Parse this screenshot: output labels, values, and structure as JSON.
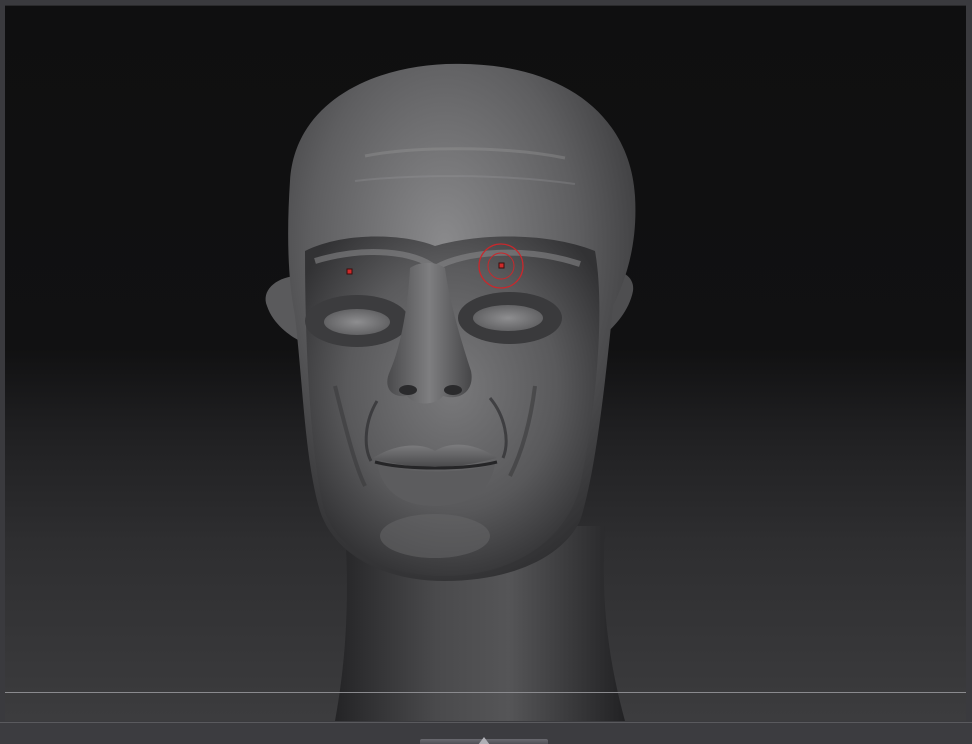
{
  "app": {
    "view": "3d-viewport",
    "model": "sculpted-head"
  },
  "brush": {
    "icon": "brush-cursor-icon",
    "color": "#c8282c"
  },
  "symmetry_markers": {
    "icon": "symmetry-point-icon",
    "color": "#d02a2a"
  },
  "bottom_tray": {
    "icon": "tray-toggle-arrow-icon"
  }
}
